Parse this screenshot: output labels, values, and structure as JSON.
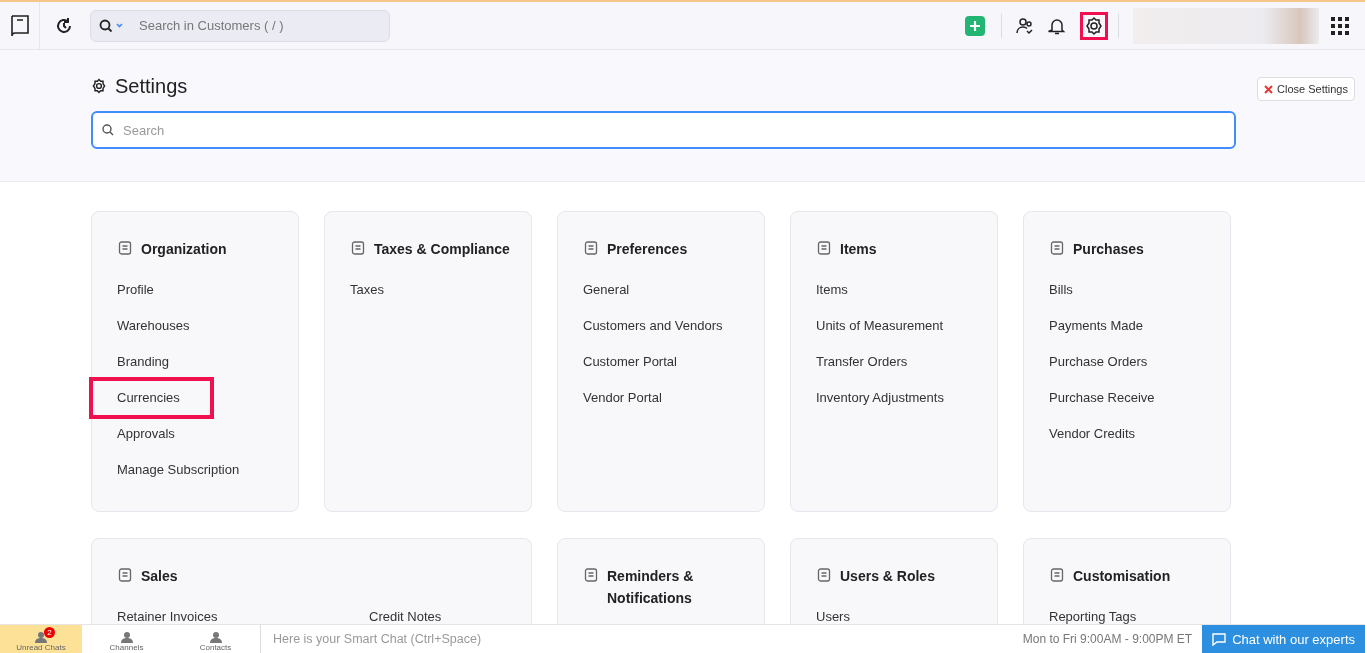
{
  "topbar": {
    "search_placeholder": "Search in Customers ( / )",
    "settings_highlighted": true
  },
  "header": {
    "title": "Settings",
    "search_placeholder": "Search",
    "close_label": "Close Settings"
  },
  "cards": [
    {
      "title": "Organization",
      "wide": false,
      "items": [
        {
          "label": "Profile",
          "highlighted": false
        },
        {
          "label": "Warehouses",
          "highlighted": false
        },
        {
          "label": "Branding",
          "highlighted": false
        },
        {
          "label": "Currencies",
          "highlighted": true
        },
        {
          "label": "Approvals",
          "highlighted": false
        },
        {
          "label": "Manage Subscription",
          "highlighted": false
        }
      ]
    },
    {
      "title": "Taxes & Compliance",
      "wide": false,
      "items": [
        {
          "label": "Taxes",
          "highlighted": false
        }
      ]
    },
    {
      "title": "Preferences",
      "wide": false,
      "items": [
        {
          "label": "General",
          "highlighted": false
        },
        {
          "label": "Customers and Vendors",
          "highlighted": false
        },
        {
          "label": "Customer Portal",
          "highlighted": false
        },
        {
          "label": "Vendor Portal",
          "highlighted": false
        }
      ]
    },
    {
      "title": "Items",
      "wide": false,
      "items": [
        {
          "label": "Items",
          "highlighted": false
        },
        {
          "label": "Units of Measurement",
          "highlighted": false
        },
        {
          "label": "Transfer Orders",
          "highlighted": false
        },
        {
          "label": "Inventory Adjustments",
          "highlighted": false
        }
      ]
    },
    {
      "title": "Purchases",
      "wide": false,
      "items": [
        {
          "label": "Bills",
          "highlighted": false
        },
        {
          "label": "Payments Made",
          "highlighted": false
        },
        {
          "label": "Purchase Orders",
          "highlighted": false
        },
        {
          "label": "Purchase Receive",
          "highlighted": false
        },
        {
          "label": "Vendor Credits",
          "highlighted": false
        }
      ]
    },
    {
      "title": "Sales",
      "wide": true,
      "items": [
        {
          "label": "Retainer Invoices",
          "highlighted": false
        },
        {
          "label": "Credit Notes",
          "highlighted": false
        }
      ]
    },
    {
      "title": "Reminders & Notifications",
      "wide": false
    },
    {
      "title": "Users & Roles",
      "wide": false,
      "items": [
        {
          "label": "Users",
          "highlighted": false
        }
      ]
    },
    {
      "title": "Customisation",
      "wide": false,
      "items": [
        {
          "label": "Reporting Tags",
          "highlighted": false
        }
      ]
    }
  ],
  "bottombar": {
    "tabs": [
      {
        "label": "Unread Chats",
        "badge": "2",
        "selected": true
      },
      {
        "label": "Channels",
        "selected": false
      },
      {
        "label": "Contacts",
        "selected": false
      }
    ],
    "chat_placeholder": "Here is your Smart Chat (Ctrl+Space)",
    "hours": "Mon to Fri 9:00AM - 9:00PM ET",
    "chat_button": "Chat with our experts"
  }
}
